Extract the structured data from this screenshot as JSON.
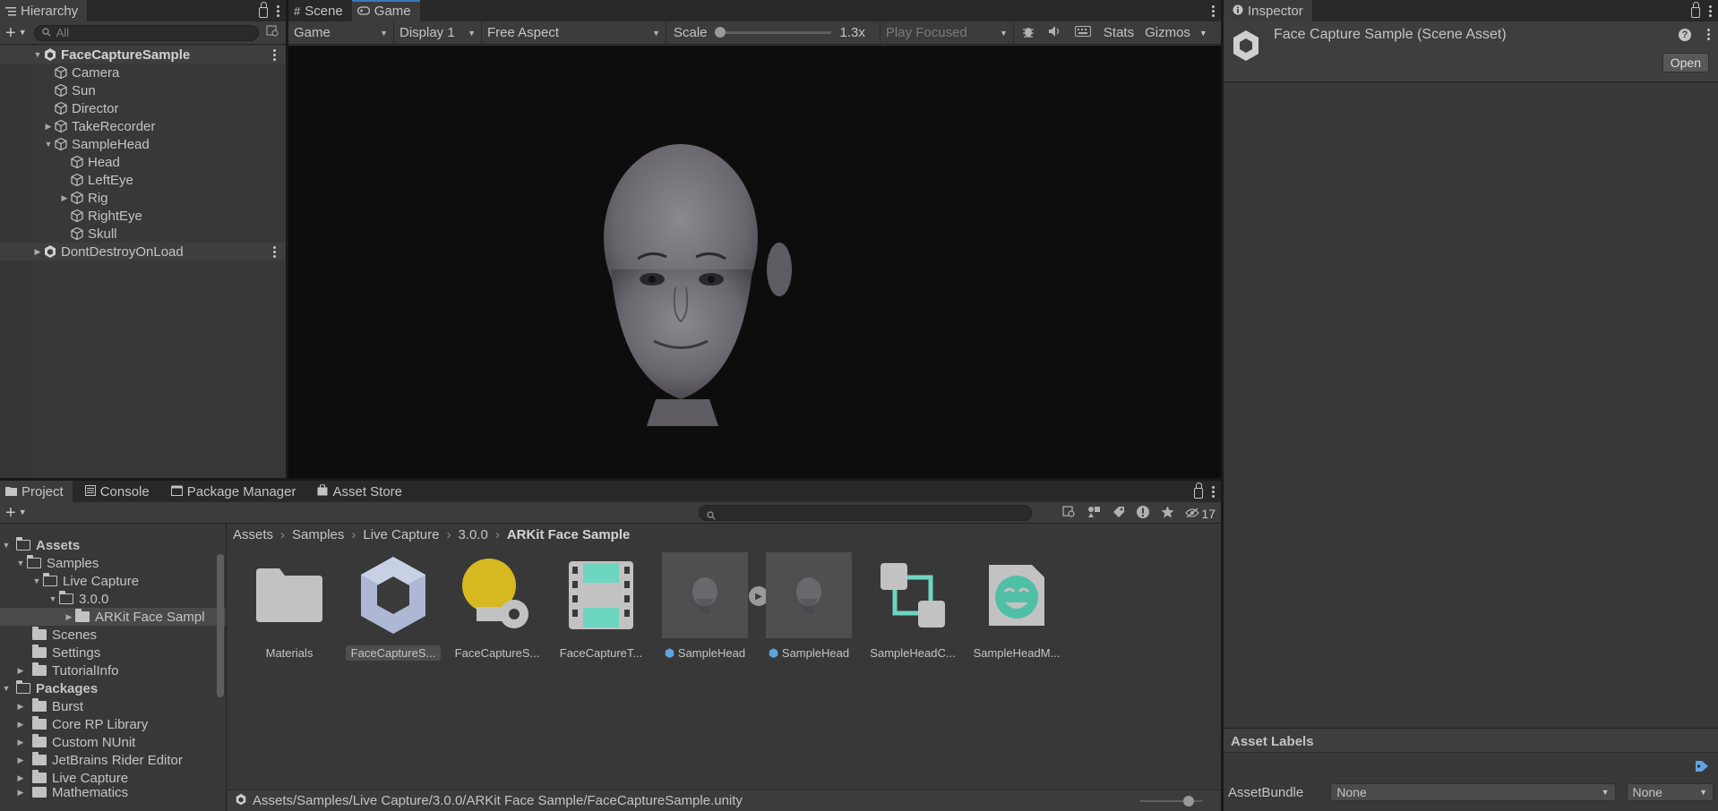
{
  "hierarchy": {
    "tab_label": "Hierarchy",
    "search_placeholder": "All",
    "items": [
      {
        "label": "FaceCaptureSample"
      },
      {
        "label": "Camera"
      },
      {
        "label": "Sun"
      },
      {
        "label": "Director"
      },
      {
        "label": "TakeRecorder"
      },
      {
        "label": "SampleHead"
      },
      {
        "label": "Head"
      },
      {
        "label": "LeftEye"
      },
      {
        "label": "Rig"
      },
      {
        "label": "RightEye"
      },
      {
        "label": "Skull"
      },
      {
        "label": "DontDestroyOnLoad"
      }
    ]
  },
  "viewtabs": {
    "scene_label": "Scene",
    "game_label": "Game"
  },
  "game_toolbar": {
    "mode": "Game",
    "display": "Display 1",
    "aspect": "Free Aspect",
    "scale_label": "Scale",
    "scale_value": "1.3x",
    "play_mode": "Play Focused",
    "stats_label": "Stats",
    "gizmos_label": "Gizmos"
  },
  "inspector": {
    "tab_label": "Inspector",
    "title": "Face Capture Sample (Scene Asset)",
    "open_label": "Open",
    "asset_labels": "Asset Labels",
    "assetbundle_label": "AssetBundle",
    "assetbundle_value": "None",
    "variant_value": "None"
  },
  "project": {
    "tabs": {
      "project": "Project",
      "console": "Console",
      "package_manager": "Package Manager",
      "asset_store": "Asset Store"
    },
    "hidden_count": "17",
    "tree": [
      {
        "label": "Assets"
      },
      {
        "label": "Samples"
      },
      {
        "label": "Live Capture"
      },
      {
        "label": "3.0.0"
      },
      {
        "label": "ARKit Face Sampl"
      },
      {
        "label": "Scenes"
      },
      {
        "label": "Settings"
      },
      {
        "label": "TutorialInfo"
      },
      {
        "label": "Packages"
      },
      {
        "label": "Burst"
      },
      {
        "label": "Core RP Library"
      },
      {
        "label": "Custom NUnit"
      },
      {
        "label": "JetBrains Rider Editor"
      },
      {
        "label": "Live Capture"
      },
      {
        "label": "Mathematics"
      }
    ],
    "breadcrumb": [
      "Assets",
      "Samples",
      "Live Capture",
      "3.0.0",
      "ARKit Face Sample"
    ],
    "assets": [
      {
        "name": "Materials",
        "icon": "folder-icon"
      },
      {
        "name": "FaceCaptureS...",
        "icon": "unity-scene-icon"
      },
      {
        "name": "FaceCaptureS...",
        "icon": "lighting-settings-icon"
      },
      {
        "name": "FaceCaptureT...",
        "icon": "timeline-icon"
      },
      {
        "name": "SampleHead",
        "icon": "model-prefab-icon"
      },
      {
        "name": "SampleHead",
        "icon": "prefab-icon"
      },
      {
        "name": "SampleHeadC...",
        "icon": "node-graph-icon"
      },
      {
        "name": "SampleHeadM...",
        "icon": "face-mapper-icon"
      }
    ],
    "status_path": "Assets/Samples/Live Capture/3.0.0/ARKit Face Sample/FaceCaptureSample.unity"
  },
  "colors": {
    "accent": "#3a79bb",
    "panel_bg": "#383838",
    "game_bg": "#0d0d0d"
  }
}
